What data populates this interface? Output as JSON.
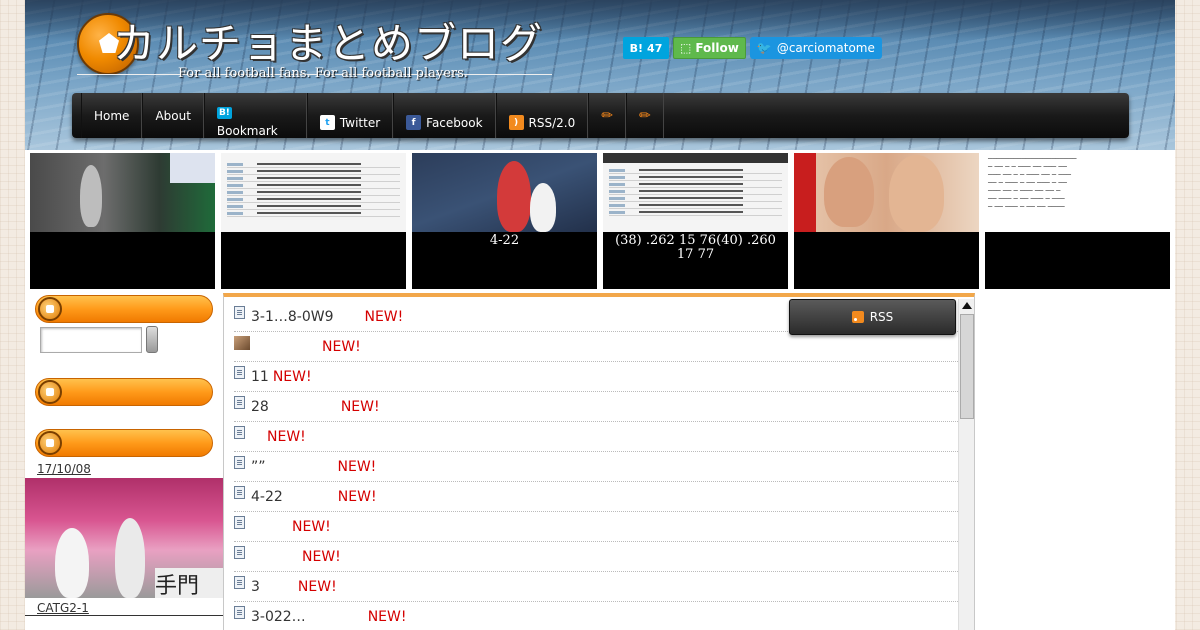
{
  "header": {
    "site_title": "カルチョまとめブログ",
    "tagline": "For all football fans.  For all football players.",
    "hatena_count": "47",
    "follow_label": "Follow",
    "twitter_handle": "@carciomatome"
  },
  "nav": {
    "items": [
      {
        "label": "Home"
      },
      {
        "label": "About"
      },
      {
        "label": "Bookmark"
      },
      {
        "label": "Twitter"
      },
      {
        "label": "Facebook"
      },
      {
        "label": "RSS/2.0"
      }
    ]
  },
  "thumbnails": [
    {
      "caption": ""
    },
    {
      "caption": ""
    },
    {
      "caption": "4-22"
    },
    {
      "caption": "(38) .262 15 76(40) .260 17 77"
    },
    {
      "caption": ""
    },
    {
      "caption": ""
    }
  ],
  "sidebar": {
    "date": "17/10/08",
    "caption": "CATG2-1"
  },
  "main": {
    "rss_label": "RSS",
    "new_label": "NEW!",
    "items": [
      {
        "text": "3-1…8-0W9"
      },
      {
        "text": ""
      },
      {
        "text": "11"
      },
      {
        "text": "28"
      },
      {
        "text": ""
      },
      {
        "text": "””"
      },
      {
        "text": "4-22"
      },
      {
        "text": ""
      },
      {
        "text": ""
      },
      {
        "text": "3"
      },
      {
        "text": "3-022…"
      }
    ]
  },
  "colors": {
    "accent_orange": "#ff9a1a",
    "nav_dark": "#1a1a1a",
    "new_red": "#d40000",
    "hatena_blue": "#00a4de",
    "twitter_blue": "#1b95e0"
  }
}
